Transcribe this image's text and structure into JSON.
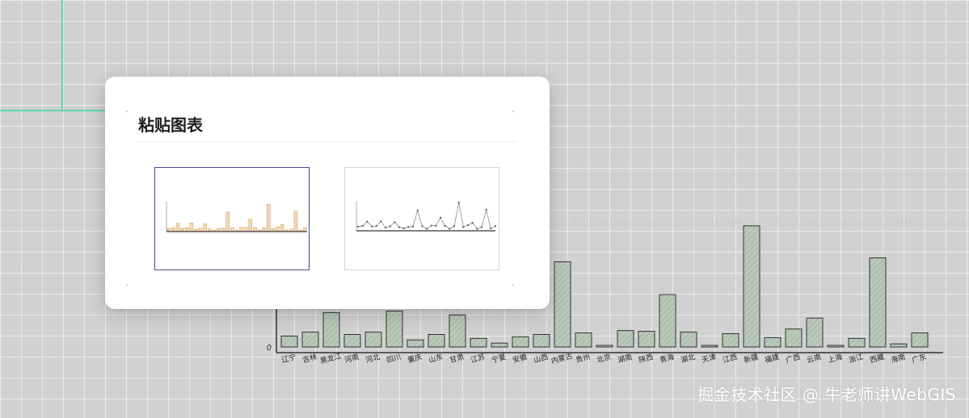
{
  "dialog": {
    "title": "粘贴图表",
    "options": [
      {
        "name": "bar-chart-option",
        "selected": true
      },
      {
        "name": "line-chart-option",
        "selected": false
      }
    ]
  },
  "watermark": "掘金技术社区 @ 牛老师讲WebGIS",
  "chart_data": {
    "type": "bar",
    "title": "",
    "xlabel": "",
    "ylabel": "",
    "y_tick_labels": [
      "0"
    ],
    "categories": [
      "辽宁",
      "吉林",
      "黑龙江",
      "河南",
      "河北",
      "四川",
      "重庆",
      "山东",
      "甘肃",
      "江苏",
      "宁夏",
      "安徽",
      "山西",
      "内蒙古",
      "贵州",
      "北京",
      "湖南",
      "陕西",
      "青海",
      "湖北",
      "天津",
      "江西",
      "新疆",
      "福建",
      "广西",
      "云南",
      "上海",
      "浙江",
      "西藏",
      "海南",
      "广东"
    ],
    "values": [
      14,
      19,
      44,
      16,
      19,
      46,
      9,
      16,
      41,
      11,
      5,
      13,
      16,
      109,
      18,
      2,
      21,
      20,
      67,
      19,
      2,
      17,
      155,
      12,
      23,
      37,
      2,
      11,
      114,
      4,
      18
    ],
    "ylim": [
      0,
      160
    ],
    "colors": {
      "bar_fill": "#b9c8b9",
      "bar_stroke": "#333333",
      "thumb_bar_fill": "#f4d8b0",
      "thumb_bar_stroke": "#c99a6a"
    }
  }
}
